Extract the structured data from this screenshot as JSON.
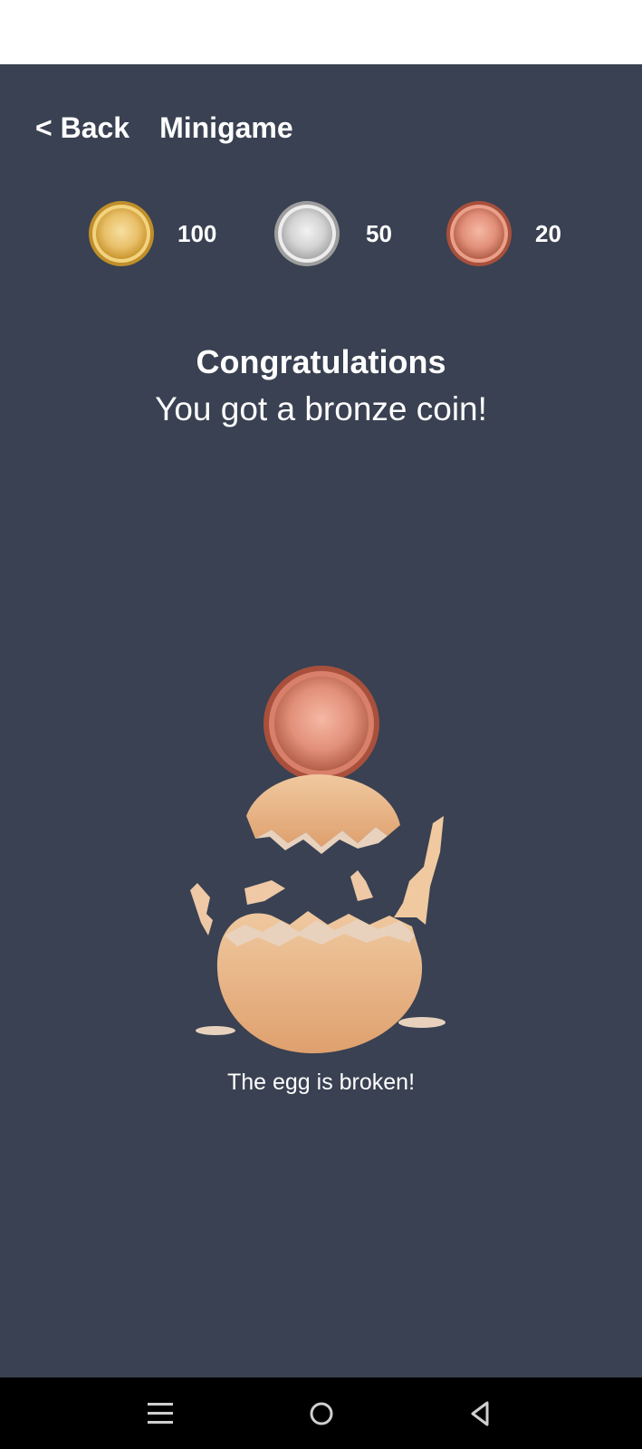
{
  "header": {
    "back_label": "< Back",
    "title": "Minigame"
  },
  "coins": [
    {
      "type": "gold",
      "count": "100",
      "icon": "gold-coin-icon",
      "color": "#E6B74A"
    },
    {
      "type": "silver",
      "count": "50",
      "icon": "silver-coin-icon",
      "color": "#CFCFCF"
    },
    {
      "type": "bronze",
      "count": "20",
      "icon": "bronze-coin-icon",
      "color": "#D9806A"
    }
  ],
  "result": {
    "heading": "Congratulations",
    "message": "You got a bronze coin!",
    "prize_icon": "bronze-coin-icon",
    "illustration_icon": "broken-egg-icon",
    "status": "The egg is broken!"
  },
  "system_nav": {
    "recents_icon": "recents-icon",
    "home_icon": "home-icon",
    "back_icon": "back-triangle-icon"
  },
  "colors": {
    "background": "#394152",
    "text": "#FFFFFF",
    "nav_bar": "#000000"
  }
}
